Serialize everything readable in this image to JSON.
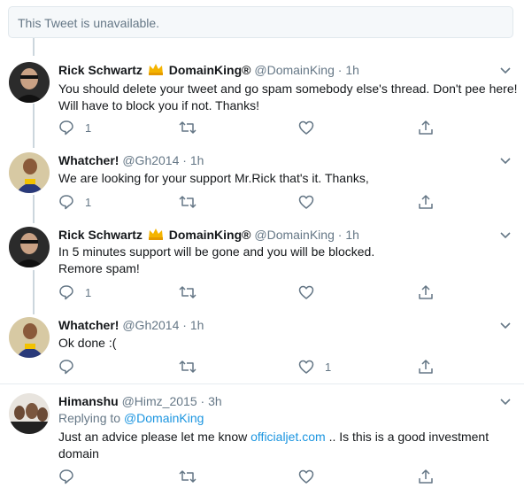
{
  "unavailable_text": "This Tweet is unavailable.",
  "tweets": [
    {
      "name": "Rick Schwartz",
      "name_suffix": "DomainKing®",
      "handle": "@DomainKing",
      "dot": "·",
      "time": "1h",
      "text": "You should delete your tweet and go spam somebody else's thread. Don't pee here!\nWill have to block you if not. Thanks!",
      "reply_count": "1",
      "like_count": ""
    },
    {
      "name": "Whatcher!",
      "handle": "@Gh2014",
      "dot": "·",
      "time": "1h",
      "text": "We are looking for your support Mr.Rick that's it. Thanks,",
      "reply_count": "1",
      "like_count": ""
    },
    {
      "name": "Rick Schwartz",
      "name_suffix": "DomainKing®",
      "handle": "@DomainKing",
      "dot": "·",
      "time": "1h",
      "text": "In 5 minutes support will be gone and you will be blocked.\nRemore spam!",
      "reply_count": "1",
      "like_count": ""
    },
    {
      "name": "Whatcher!",
      "handle": "@Gh2014",
      "dot": "·",
      "time": "1h",
      "text": "Ok done :(",
      "reply_count": "",
      "like_count": "1"
    },
    {
      "name": "Himanshu",
      "handle": "@Himz_2015",
      "dot": "·",
      "time": "3h",
      "replying_prefix": "Replying to ",
      "replying_handle": "@DomainKing",
      "text_before": "Just an advice please let me know ",
      "text_link": "officialjet.com",
      "text_after": " .. Is this is a good investment\ndomain",
      "reply_count": "",
      "like_count": ""
    }
  ],
  "icons": [
    "reply-icon",
    "retweet-icon",
    "like-icon",
    "share-icon",
    "chevron-down-icon",
    "crown-icon"
  ],
  "colors": {
    "text": "#14171a",
    "muted": "#657786",
    "link": "#1b95e0",
    "border": "#e6ecf0",
    "thread": "#ccd6dd"
  }
}
